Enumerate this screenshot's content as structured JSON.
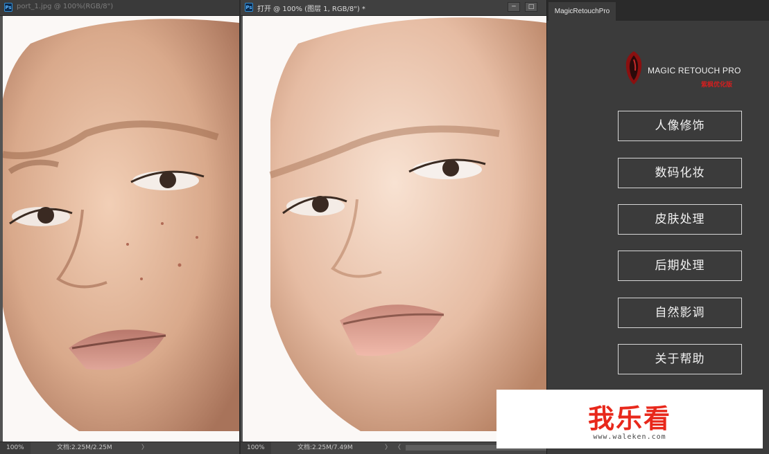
{
  "left_doc": {
    "title": "port_1.jpg @ 100%(RGB/8\")",
    "zoom": "100%",
    "doc_info": "文档:2.25M/2.25M",
    "nav_arrow": "〉"
  },
  "mid_doc": {
    "title": "打开 @ 100% (图层 1, RGB/8\") *",
    "zoom": "100%",
    "doc_info": "文档:2.25M/7.49M",
    "nav_arrow": "〉",
    "nav_left": "〈",
    "minimize": "─",
    "maximize": "□"
  },
  "panel": {
    "tab_label": "MagicRetouchPro",
    "brand": "MAGIC RETOUCH PRO",
    "brand_sub": "紫枫优化版",
    "buttons": [
      {
        "label": "人像修饰"
      },
      {
        "label": "数码化妆"
      },
      {
        "label": "皮肤处理"
      },
      {
        "label": "后期处理"
      },
      {
        "label": "自然影调"
      },
      {
        "label": "关于帮助"
      }
    ]
  },
  "watermark": {
    "text": "我乐看",
    "url": "www.waleken.com"
  },
  "colors": {
    "accent_red": "#d02020",
    "watermark_red": "#e8281b",
    "panel_bg": "#3b3b3b"
  }
}
